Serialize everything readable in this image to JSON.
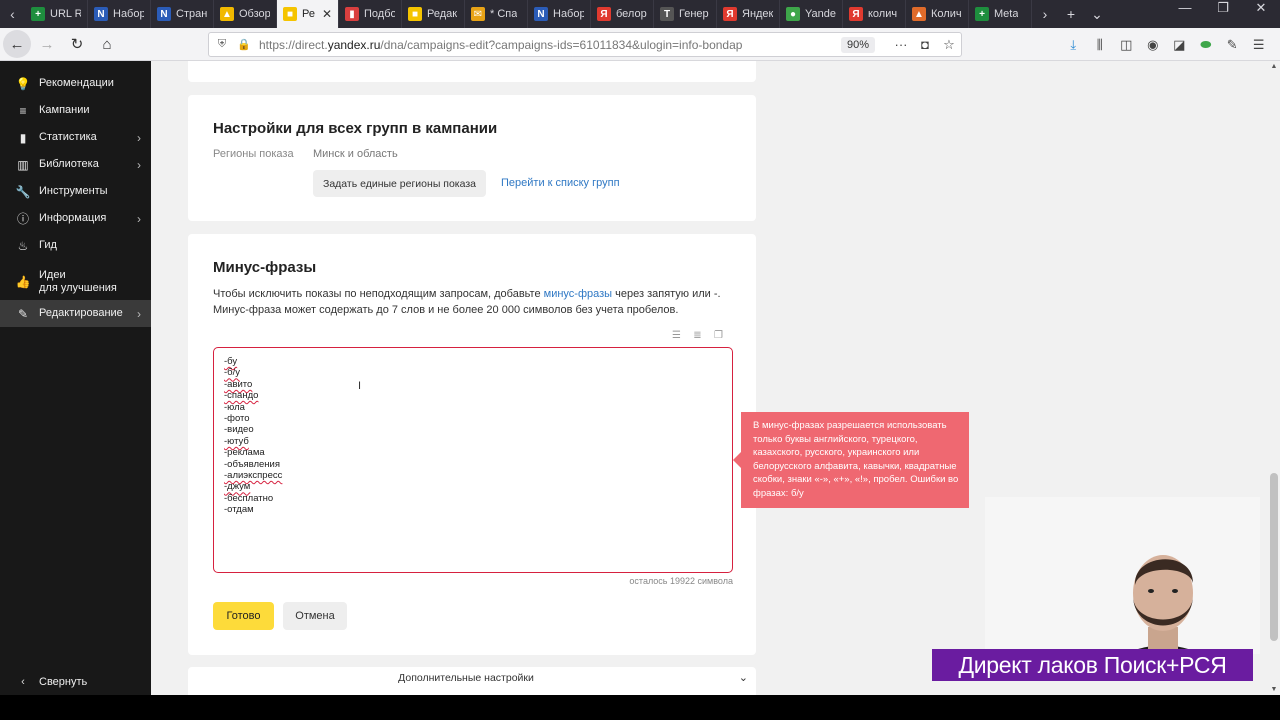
{
  "browser": {
    "tabs": [
      {
        "label": "URL R",
        "fav_color": "#1e8e3e",
        "fav_glyph": "+"
      },
      {
        "label": "Набор",
        "fav_color": "#2b5cb8",
        "fav_glyph": "N"
      },
      {
        "label": "Стран",
        "fav_color": "#2b5cb8",
        "fav_glyph": "N"
      },
      {
        "label": "Обзор",
        "fav_color": "#f1b900",
        "fav_glyph": "▲"
      },
      {
        "label": "Ре",
        "fav_color": "#f5c400",
        "fav_glyph": "■",
        "active": true
      },
      {
        "label": "Подбо",
        "fav_color": "#d93f3f",
        "fav_glyph": "▮"
      },
      {
        "label": "Редак",
        "fav_color": "#f5c400",
        "fav_glyph": "■"
      },
      {
        "label": "* Спа",
        "fav_color": "#e8a317",
        "fav_glyph": "✉"
      },
      {
        "label": "Набор",
        "fav_color": "#2b5cb8",
        "fav_glyph": "N"
      },
      {
        "label": "белор",
        "fav_color": "#e03a2f",
        "fav_glyph": "Я"
      },
      {
        "label": "Генер",
        "fav_color": "#555555",
        "fav_glyph": "T"
      },
      {
        "label": "Яндек",
        "fav_color": "#e03a2f",
        "fav_glyph": "Я"
      },
      {
        "label": "Yande",
        "fav_color": "#3ea64a",
        "fav_glyph": "●"
      },
      {
        "label": "колич",
        "fav_color": "#e03a2f",
        "fav_glyph": "Я"
      },
      {
        "label": "Колич",
        "fav_color": "#e06b2a",
        "fav_glyph": "▲"
      },
      {
        "label": "Meta",
        "fav_color": "#1e8e3e",
        "fav_glyph": "+"
      }
    ],
    "url_prefix": "https://direct.",
    "url_domain": "yandex.ru",
    "url_rest": "/dna/campaigns-edit?campaigns-ids=61011834&ulogin=info-bondap",
    "zoom": "90%"
  },
  "sidebar": {
    "items": [
      {
        "label": "Рекомендации",
        "icon": "lightbulb-icon",
        "glyph": "💡",
        "arrow": false
      },
      {
        "label": "Кампании",
        "icon": "stack-icon",
        "glyph": "≡",
        "arrow": false
      },
      {
        "label": "Статистика",
        "icon": "bar-chart-icon",
        "glyph": "▮",
        "arrow": true
      },
      {
        "label": "Библиотека",
        "icon": "library-icon",
        "glyph": "▥",
        "arrow": true
      },
      {
        "label": "Инструменты",
        "icon": "wrench-icon",
        "glyph": "🔧",
        "arrow": false
      },
      {
        "label": "Информация",
        "icon": "info-icon",
        "glyph": "ⓘ",
        "arrow": true
      },
      {
        "label": "Гид",
        "icon": "guide-icon",
        "glyph": "♨",
        "arrow": false
      },
      {
        "label": "Идеи",
        "label2": "для улучшения",
        "icon": "thumbs-up-icon",
        "glyph": "👍",
        "arrow": false
      },
      {
        "label": "Редактирование",
        "icon": "pencil-icon",
        "glyph": "✎",
        "arrow": true,
        "active": true
      }
    ],
    "collapse_label": "Свернуть"
  },
  "settings": {
    "title": "Настройки для всех групп в кампании",
    "regions_key": "Регионы показа",
    "regions_value": "Минск и область",
    "set_regions_button": "Задать единые регионы показа",
    "groups_link": "Перейти к списку групп"
  },
  "minus": {
    "title": "Минус-фразы",
    "desc_part1": "Чтобы исключить показы по неподходящим запросам, добавьте ",
    "desc_link": "минус-фразы",
    "desc_part2": " через запятую или -.",
    "desc_line2": "Минус-фраза может содержать до 7 слов и не более 20 000 символов без учета пробелов.",
    "phrases": [
      {
        "text": "-бу",
        "error": true
      },
      {
        "text": "-б/у",
        "error": true
      },
      {
        "text": "-авито",
        "error": true
      },
      {
        "text": "-спандо",
        "error": true
      },
      {
        "text": "-юла",
        "error": false
      },
      {
        "text": "-фото",
        "error": false
      },
      {
        "text": "-видео",
        "error": false
      },
      {
        "text": "-ютуб",
        "error": true
      },
      {
        "text": "-реклама",
        "error": false
      },
      {
        "text": "-объявления",
        "error": false
      },
      {
        "text": "-алиэкспресс",
        "error": true
      },
      {
        "text": "-джум",
        "error": true
      },
      {
        "text": "-бесплатно",
        "error": false
      },
      {
        "text": "-отдам",
        "error": false
      }
    ],
    "remaining": "осталось 19922 символа",
    "done_button": "Готово",
    "cancel_button": "Отмена",
    "error_tooltip": "В минус-фразах разрешается использовать только буквы английского, турецкого, казахского, русского, украинского или белорусского алфавита, кавычки, квадратные скобки, знаки «-», «+», «!», пробел. Ошибки во фразах: б/у"
  },
  "extra_settings_label": "Дополнительные настройки",
  "overlay_caption": "Директ лаков Поиск+РСЯ",
  "colors": {
    "error": "#d6213f",
    "tooltip": "#ef6871",
    "primary_button": "#fddb3a",
    "link": "#2f78c4",
    "caption_bg": "#6a1ca0"
  }
}
